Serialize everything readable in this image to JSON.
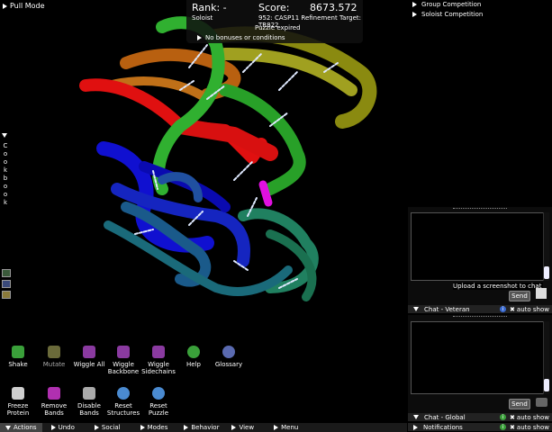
{
  "top_left": {
    "pull_mode": "Pull Mode"
  },
  "score_panel": {
    "rank_label": "Rank: -",
    "score_label": "Score:",
    "score_value": "8673.572",
    "mode": "Soloist",
    "puzzle": "952: CASP11 Refinement Target: TR822",
    "status": "Puzzle expired",
    "bonuses": "No bonuses or conditions"
  },
  "competitions": {
    "group": "Group Competition",
    "soloist": "Soloist Competition"
  },
  "cookbook": {
    "letters": [
      "C",
      "o",
      "o",
      "k",
      "b",
      "o",
      "o",
      "k"
    ]
  },
  "chat_veteran": {
    "upload_tip": "Upload a screenshot to chat",
    "send": "Send",
    "title": "Chat - Veteran",
    "auto_show": "auto show"
  },
  "chat_global": {
    "send": "Send",
    "title": "Chat - Global",
    "auto_show": "auto show"
  },
  "notifications": {
    "title": "Notifications",
    "auto_show": "auto show"
  },
  "tools": [
    {
      "label": "Shake",
      "color": "#3aa03a"
    },
    {
      "label": "Mutate",
      "color": "#6a6a3a"
    },
    {
      "label": "Wiggle All",
      "color": "#8a3aa0"
    },
    {
      "label": "Wiggle Backbone",
      "color": "#8a3aa0"
    },
    {
      "label": "Wiggle Sidechains",
      "color": "#8a3aa0"
    },
    {
      "label": "Help",
      "color": "#3aa03a"
    },
    {
      "label": "Glossary",
      "color": "#5a6ab0"
    },
    {
      "label": "Freeze Protein",
      "color": "#cfcfcf"
    },
    {
      "label": "Remove Bands",
      "color": "#b030b0"
    },
    {
      "label": "Disable Bands",
      "color": "#aaaaaa"
    },
    {
      "label": "Reset Structures",
      "color": "#4a8ad0"
    },
    {
      "label": "Reset Puzzle",
      "color": "#4a8ad0"
    }
  ],
  "bottom_menu": [
    "Actions",
    "Undo",
    "Social",
    "Modes",
    "Behavior",
    "View",
    "Menu"
  ]
}
